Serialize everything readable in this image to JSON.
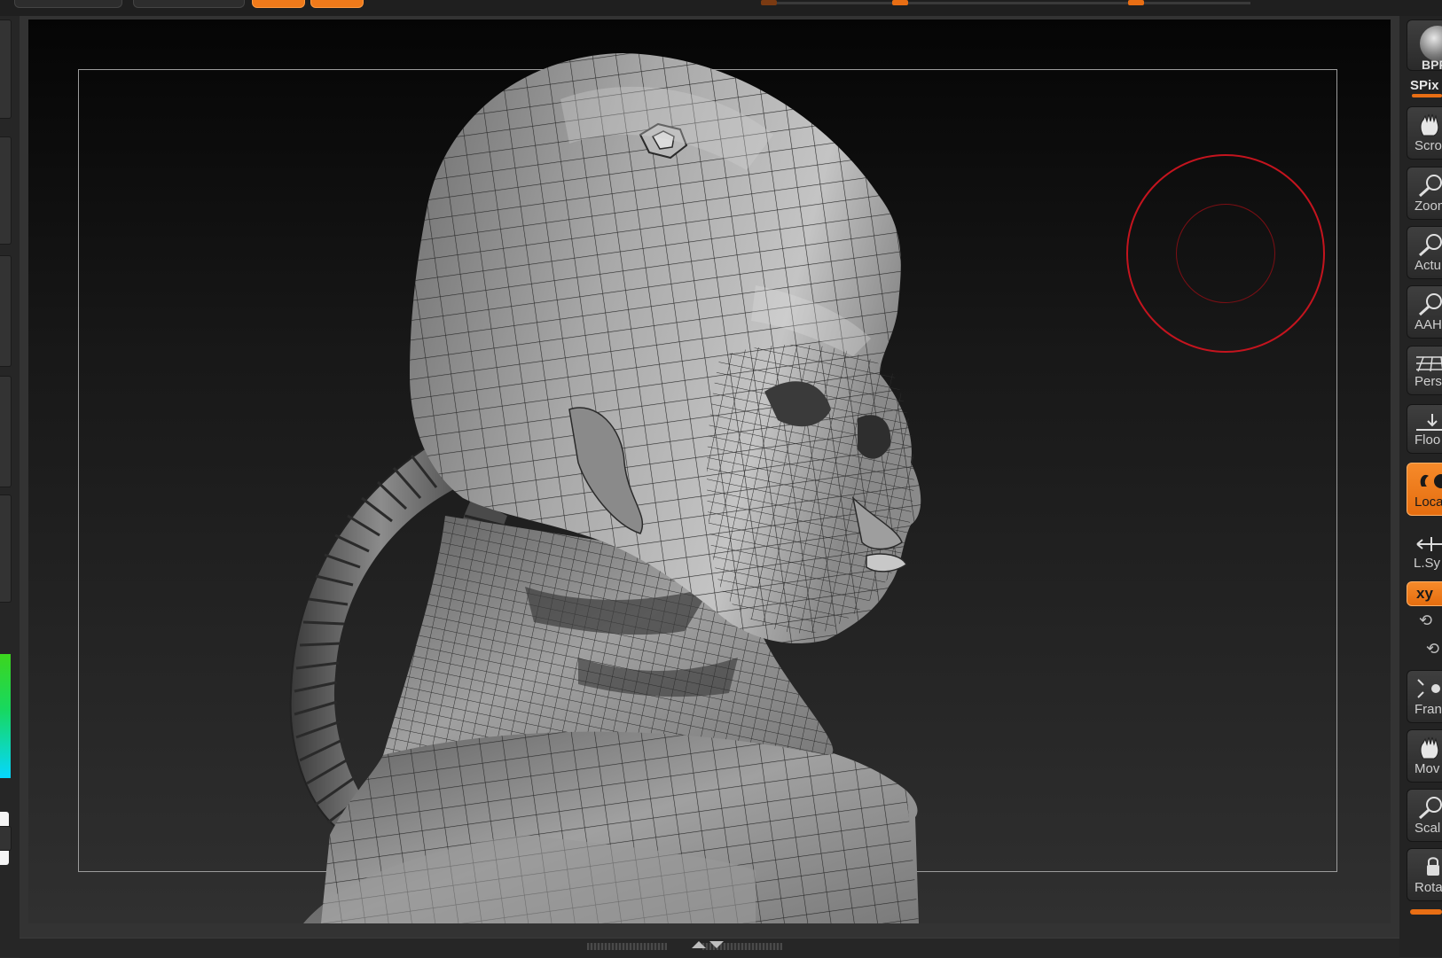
{
  "right_shelf": {
    "bpr_label": "BPR",
    "spix_label": "SPix",
    "buttons": [
      {
        "id": "scroll",
        "label": "Scro",
        "icon": "hand-icon"
      },
      {
        "id": "zoom",
        "label": "Zoom",
        "icon": "magnifier-icon"
      },
      {
        "id": "actual",
        "label": "Actu",
        "icon": "magnifier-icon"
      },
      {
        "id": "aahalf",
        "label": "AAHa",
        "icon": "magnifier-icon"
      },
      {
        "id": "persp",
        "label": "Persp",
        "icon": "perspective-grid-icon"
      },
      {
        "id": "floor",
        "label": "Floo",
        "icon": "floor-icon"
      },
      {
        "id": "local",
        "label": "Loca",
        "icon": "local-symmetry-icon",
        "active": true
      },
      {
        "id": "lsym",
        "label": "L.Sy",
        "icon": "lsym-icon"
      },
      {
        "id": "xyz",
        "label": "xy",
        "icon": "xyz-rotate-icon",
        "active": true
      },
      {
        "id": "frame",
        "label": "Fran",
        "icon": "frame-icon"
      },
      {
        "id": "move",
        "label": "Mov",
        "icon": "hand-icon"
      },
      {
        "id": "scale",
        "label": "Scal",
        "icon": "magnifier-icon"
      },
      {
        "id": "rotate",
        "label": "Rota",
        "icon": "rotate-lock-icon"
      }
    ]
  },
  "colors": {
    "accent": "#e86e14",
    "brush_ring": "#c4141e",
    "canvas_top": "#050505",
    "canvas_bottom": "#303030"
  }
}
